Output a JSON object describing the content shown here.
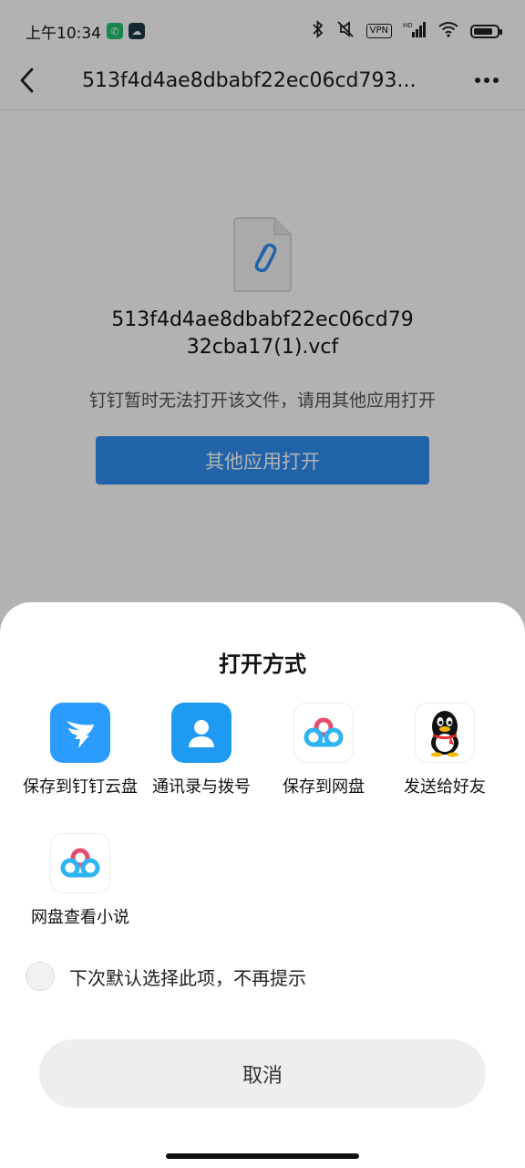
{
  "status_bar": {
    "time": "上午10:34",
    "vpn": "VPN",
    "hd": "HD"
  },
  "header": {
    "title": "513f4d4ae8dbabf22ec06cd793..."
  },
  "file": {
    "name_line1": "513f4d4ae8dbabf22ec06cd79",
    "name_line2": "32cba17(1).vcf",
    "message": "钉钉暂时无法打开该文件，请用其他应用打开",
    "open_other_label": "其他应用打开"
  },
  "sheet": {
    "title": "打开方式",
    "apps": [
      {
        "label": "保存到钉钉云盘",
        "icon": "dingtalk-icon"
      },
      {
        "label": "通讯录与拨号",
        "icon": "contacts-icon"
      },
      {
        "label": "保存到网盘",
        "icon": "baidu-netdisk-icon"
      },
      {
        "label": "发送给好友",
        "icon": "qq-penguin-icon"
      },
      {
        "label": "网盘查看小说",
        "icon": "baidu-netdisk-icon"
      }
    ],
    "default_label": "下次默认选择此项，不再提示",
    "cancel_label": "取消"
  },
  "colors": {
    "primary_blue": "#2f8ff2",
    "dingtalk_blue": "#2a9cff",
    "dim_overlay": "rgba(0,0,0,0.30)"
  }
}
